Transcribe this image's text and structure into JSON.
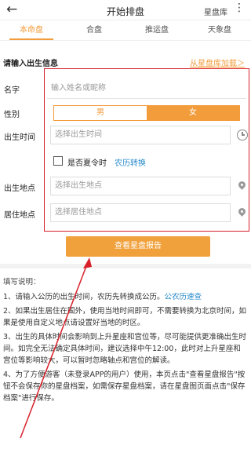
{
  "header": {
    "back_icon": "arrow-left-icon",
    "title": "开始排盘",
    "right_link": "星盘库",
    "more_icon": "more-dots-icon"
  },
  "tabs": [
    {
      "label": "本命盘",
      "active": true
    },
    {
      "label": "合盘",
      "active": false
    },
    {
      "label": "推运盘",
      "active": false
    },
    {
      "label": "天象盘",
      "active": false
    }
  ],
  "form": {
    "section_title": "请输入出生信息",
    "from_library": "从星盘库加载＞",
    "name_label": "名字",
    "name_placeholder": "输入姓名或昵称",
    "gender_label": "性别",
    "gender_male": "男",
    "gender_female": "女",
    "birth_time_label": "出生时间",
    "birth_time_placeholder": "选择出生时间",
    "dst_label": "是否夏令时",
    "lunar_convert": "农历转换",
    "birth_place_label": "出生地点",
    "birth_place_placeholder": "选择出生地点",
    "residence_label": "居住地点",
    "residence_placeholder": "选择居住地点",
    "submit": "查看星盘报告"
  },
  "notes": {
    "title": "填写说明：",
    "n1": "1、请输入公历的出生时间，农历先转换成公历。",
    "n1_link": "公农历速查",
    "n2": "2、如果出生居住在国外，使用当地时间即可，不需要转换为北京时间，如果是使用自定义地点请设置好当地的时区。",
    "n3": "3、出生的具体时间会影响到上升星座和宫位等，尽可能提供更准确出生时间。如完全无法确定具体时间，建议选择中午12:00，此时对上升星座和宫位等影响较大，可以暂时忽略轴点和宫位的解读。",
    "n4": "4、为了方便游客（未登录APP的用户）使用，本页点击\"查看星盘报告\"按钮不会保存你的星盘档案，如需保存星盘档案，请在星盘图页面点击\"保存档案\"进行保存。"
  },
  "colors": {
    "accent": "#f39c3c",
    "link": "#2a8ccc",
    "highlight_box": "#d9202a"
  }
}
